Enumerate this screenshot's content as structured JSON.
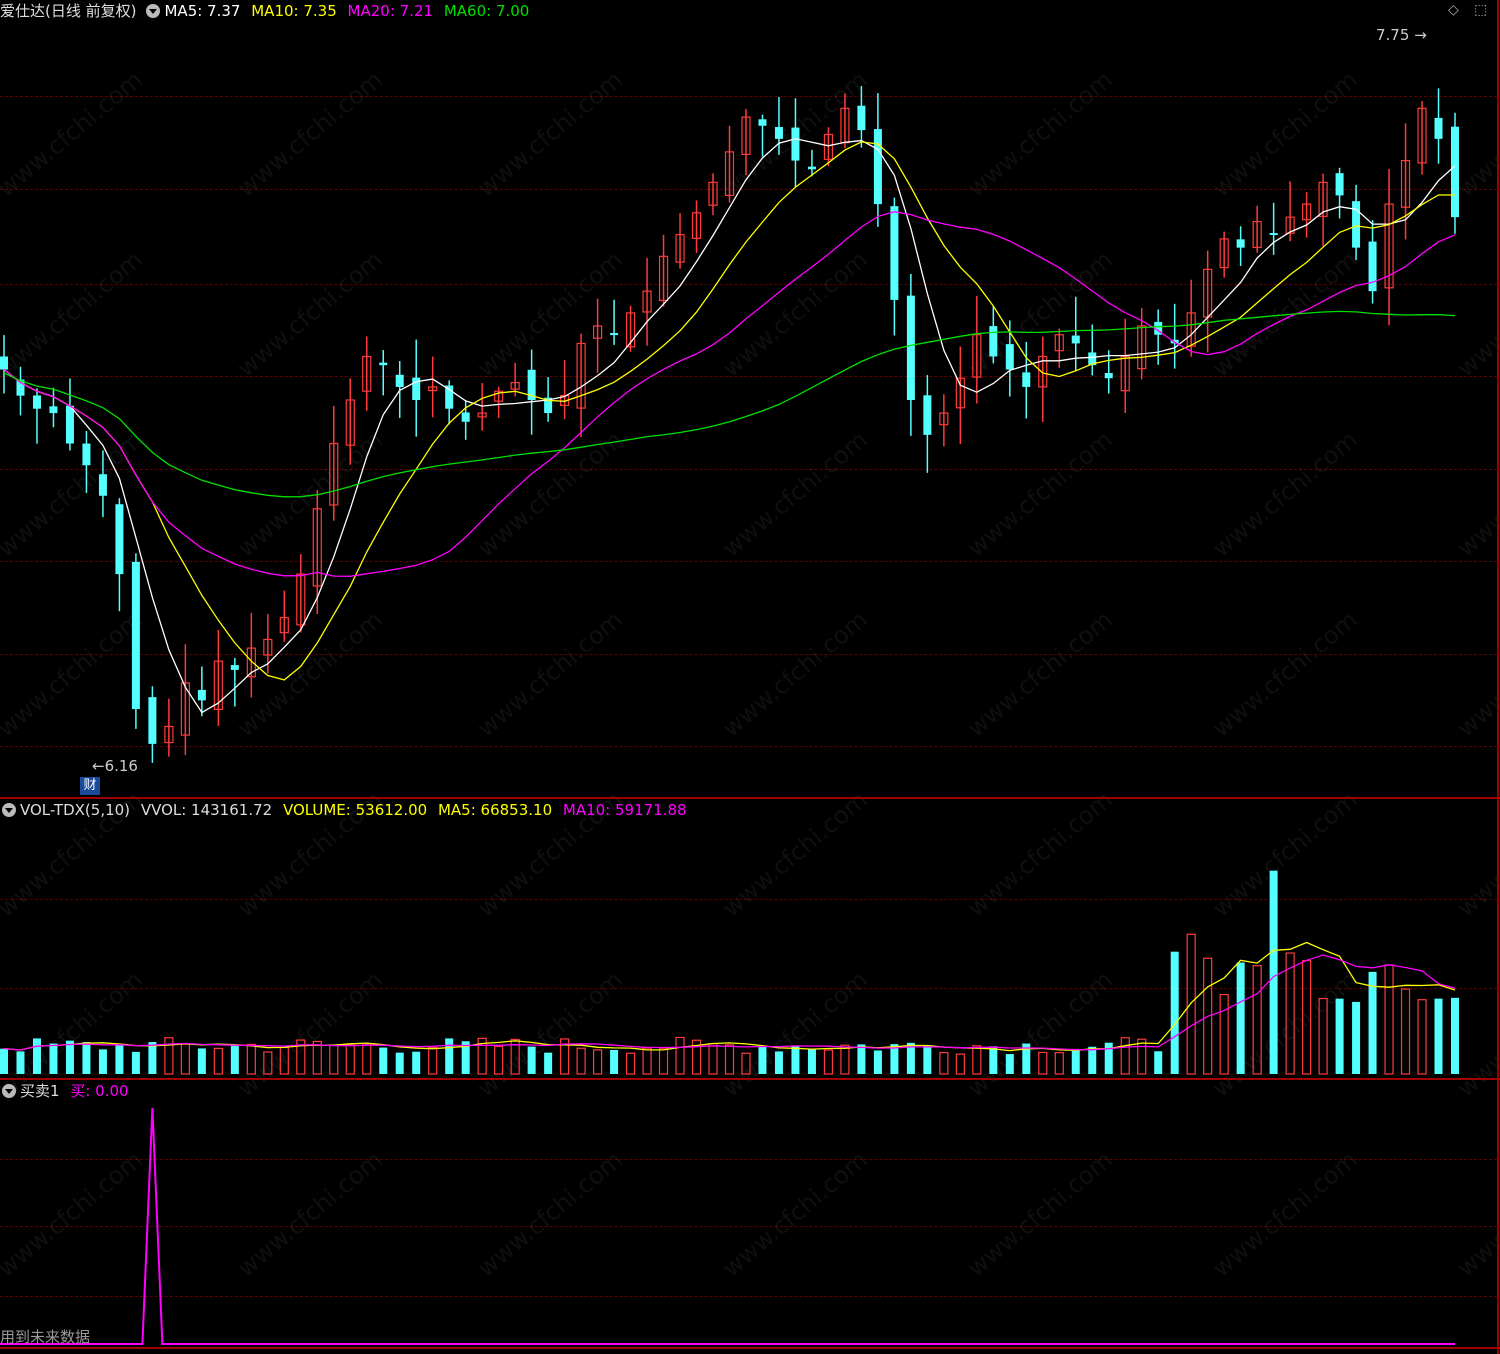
{
  "price_panel": {
    "title": "爱仕达(日线 前复权)",
    "ma5": "MA5: 7.37",
    "ma10": "MA10: 7.35",
    "ma20": "MA20: 7.21",
    "ma60": "MA60: 7.00",
    "high_label": "7.75",
    "low_label": "6.16",
    "badge": "财"
  },
  "volume_panel": {
    "name": "VOL-TDX(5,10)",
    "vvol": "VVOL: 143161.72",
    "volume": "VOLUME: 53612.00",
    "ma5": "MA5: 66853.10",
    "ma10": "MA10: 59171.88"
  },
  "signal_panel": {
    "name": "买卖1",
    "buy": "买: 0.00",
    "footer_note": "用到未来数据"
  },
  "watermark": "www.cfchi.com",
  "colors": {
    "up": "#ff3b3b",
    "down": "#54ffff",
    "ma5": "#ffffff",
    "ma10": "#ffff00",
    "ma20": "#ff00ff",
    "ma60": "#00e000",
    "grid": "#5a0000",
    "separator": "#a00000"
  },
  "chart_data": {
    "type": "candlestick",
    "price_range": [
      6.16,
      7.75
    ],
    "candles_close": [
      7.02,
      6.96,
      6.93,
      6.92,
      6.85,
      6.8,
      6.73,
      6.55,
      6.24,
      6.16,
      6.2,
      6.3,
      6.26,
      6.35,
      6.33,
      6.38,
      6.4,
      6.45,
      6.55,
      6.7,
      6.85,
      6.95,
      7.05,
      7.03,
      6.98,
      6.95,
      6.98,
      6.93,
      6.9,
      6.92,
      6.97,
      6.99,
      6.95,
      6.92,
      6.96,
      7.08,
      7.12,
      7.1,
      7.15,
      7.2,
      7.28,
      7.33,
      7.38,
      7.45,
      7.52,
      7.6,
      7.58,
      7.55,
      7.5,
      7.48,
      7.56,
      7.62,
      7.57,
      7.4,
      7.18,
      6.95,
      6.87,
      6.92,
      7.0,
      7.1,
      7.05,
      7.02,
      6.98,
      7.05,
      7.1,
      7.08,
      7.03,
      7.0,
      7.05,
      7.12,
      7.1,
      7.08,
      7.15,
      7.25,
      7.32,
      7.3,
      7.36,
      7.33,
      7.37,
      7.4,
      7.45,
      7.42,
      7.3,
      7.2,
      7.4,
      7.5,
      7.62,
      7.55,
      7.37
    ],
    "volume_max": 143161.72,
    "volume_last": 53612.0,
    "volume_ma5": 66853.1,
    "volume_ma10": 59171.88,
    "buy_signal_value": 0.0
  }
}
